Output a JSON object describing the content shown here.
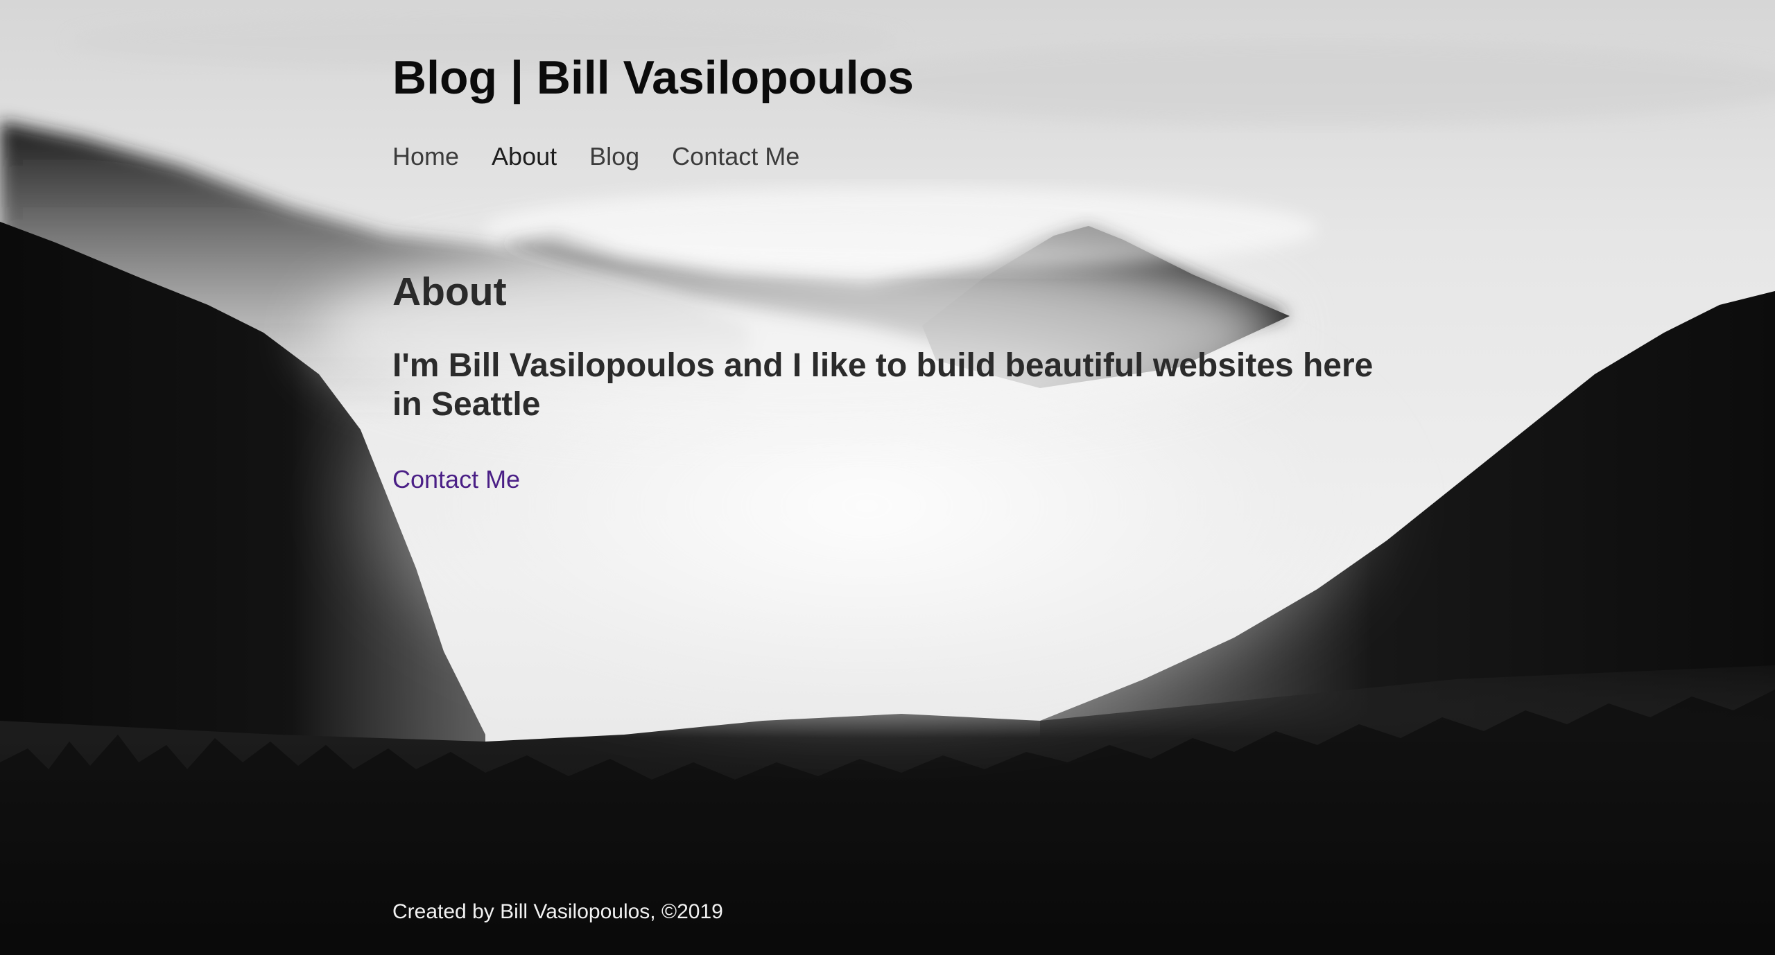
{
  "site": {
    "title": "Blog | Bill Vasilopoulos"
  },
  "nav": {
    "items": [
      {
        "label": "Home",
        "active": false
      },
      {
        "label": "About",
        "active": true
      },
      {
        "label": "Blog",
        "active": false
      },
      {
        "label": "Contact Me",
        "active": false
      }
    ]
  },
  "main": {
    "heading": "About",
    "intro": "I'm Bill Vasilopoulos and I like to build beautiful websites here in Seattle",
    "contact_link": "Contact Me"
  },
  "footer": {
    "text": "Created by Bill Vasilopoulos, ©2019"
  },
  "background": {
    "icon": "misty-forest-mountains-image"
  },
  "colors": {
    "title": "#0b0b0b",
    "nav": "#3c3c3c",
    "link": "#4a1f86",
    "footer": "#f2f2f2"
  }
}
